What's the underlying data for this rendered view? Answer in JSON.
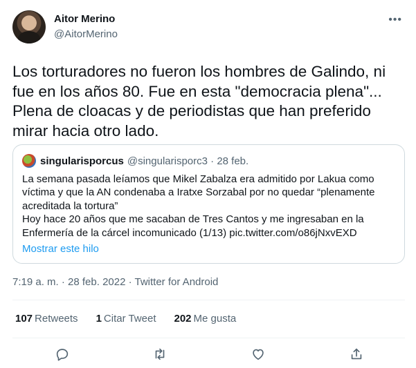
{
  "tweet": {
    "author_name": "Aitor Merino",
    "author_handle": "@AitorMerino",
    "text": "Los torturadores no fueron los hombres de Galindo, ni\nfue en los años 80. Fue en esta \"democracia plena\"...\nPlena de cloacas y de periodistas que han preferido\nmirar hacia otro lado.",
    "timestamp": "7:19 a. m. · 28 feb. 2022 · Twitter for Android"
  },
  "quote": {
    "name": "singularisporcus",
    "handle_date": "@singularisporc3 · 28 feb.",
    "text": "La semana pasada leíamos que Mikel Zabalza era admitido por Lakua como\nvíctima y que la AN condenaba a Iratxe Sorzabal por no quedar “plenamente\nacreditada la tortura”\nHoy hace 20 años que me sacaban de Tres Cantos y me ingresaban en la\nEnfermería de la cárcel incomunicado (1/13) pic.twitter.com/o86jNxvEXD",
    "show_thread": "Mostrar este hilo"
  },
  "stats": {
    "retweets_count": "107",
    "retweets_label": "Retweets",
    "quotes_count": "1",
    "quotes_label": "Citar Tweet",
    "likes_count": "202",
    "likes_label": "Me gusta"
  },
  "icons": {
    "more": "more-horizontal-icon",
    "reply": "reply-bubble-icon",
    "retweet": "retweet-icon",
    "like": "heart-icon",
    "share": "share-upload-icon"
  },
  "colors": {
    "text": "#0f1419",
    "secondary": "#536471",
    "link": "#1d9bf0",
    "border": "#cfd9de"
  }
}
